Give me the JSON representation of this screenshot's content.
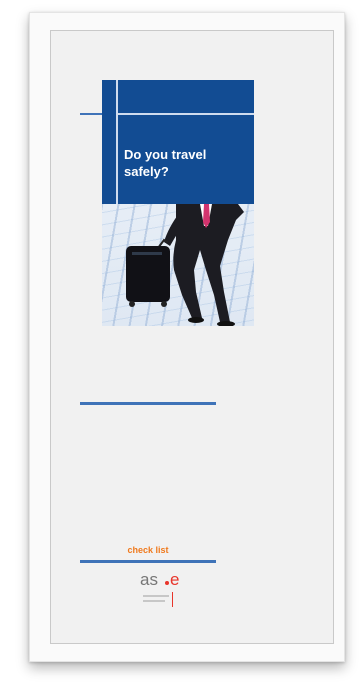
{
  "cover": {
    "title": "Do you travel safely?"
  },
  "footer": {
    "label": "check list",
    "logo_text_left": "as",
    "logo_text_right": "e"
  },
  "colors": {
    "brand_blue": "#124c93",
    "accent_orange": "#f07a1e",
    "logo_red": "#e8352b"
  }
}
